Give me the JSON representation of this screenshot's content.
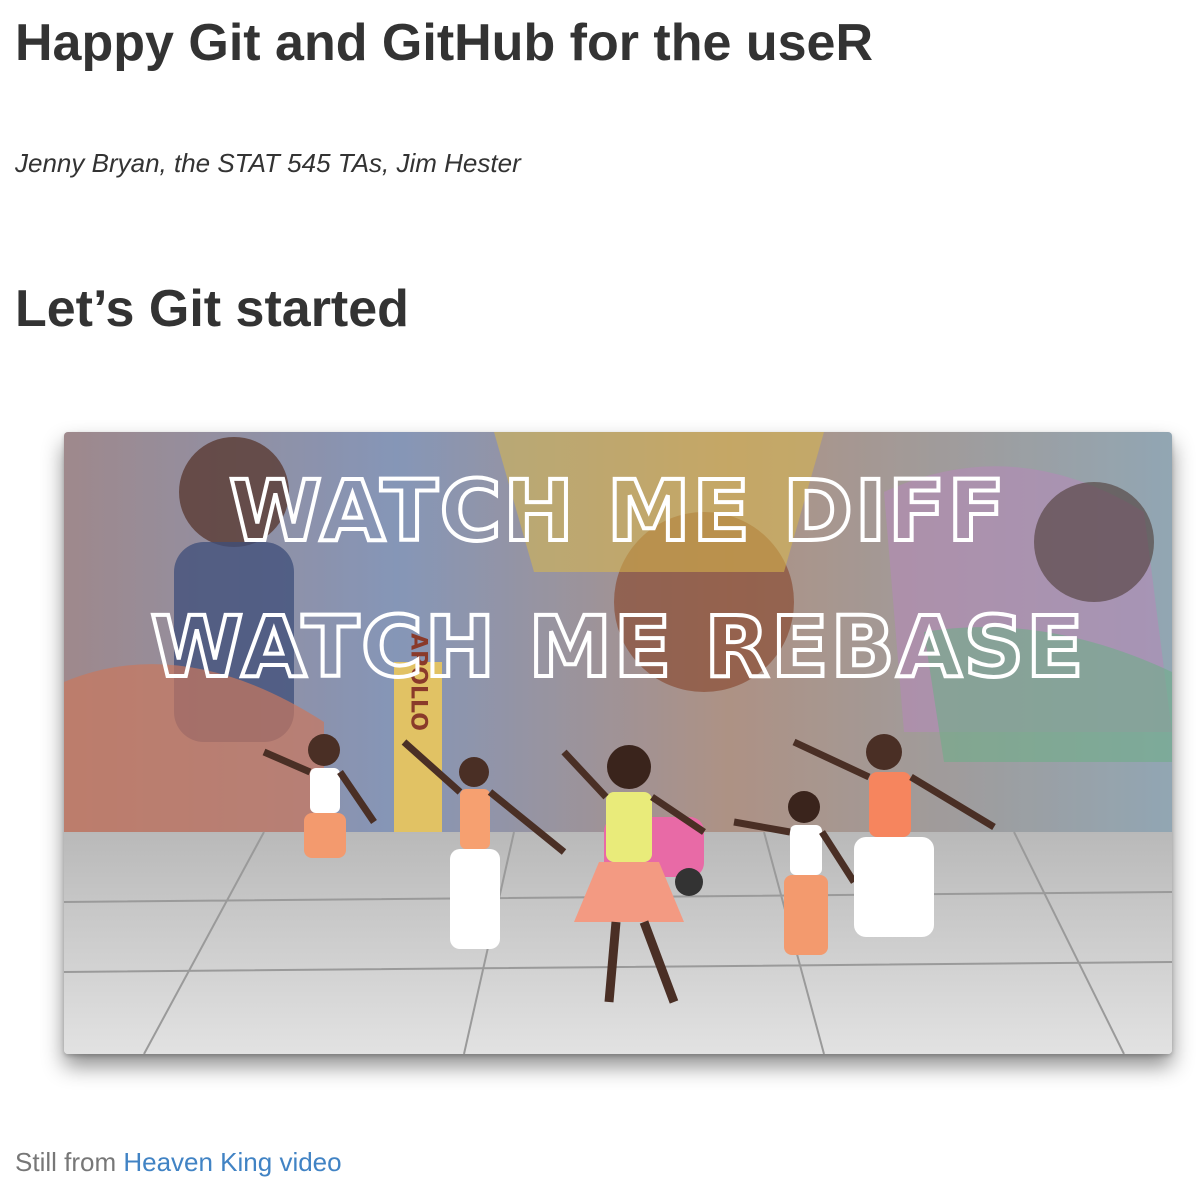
{
  "book": {
    "title": "Happy Git and GitHub for the useR",
    "authors": "Jenny Bryan, the STAT 545 TAs, Jim Hester"
  },
  "chapter": {
    "title": "Let’s Git started"
  },
  "figure": {
    "line1": "WATCH ME DIFF",
    "line2": "WATCH ME REBASE",
    "mural_sign": "APOLLO",
    "icon": "video-still-image"
  },
  "caption": {
    "prefix": "Still from ",
    "link_text": "Heaven King video"
  },
  "colors": {
    "text": "#333333",
    "caption": "#777777",
    "link": "#4183c4"
  }
}
